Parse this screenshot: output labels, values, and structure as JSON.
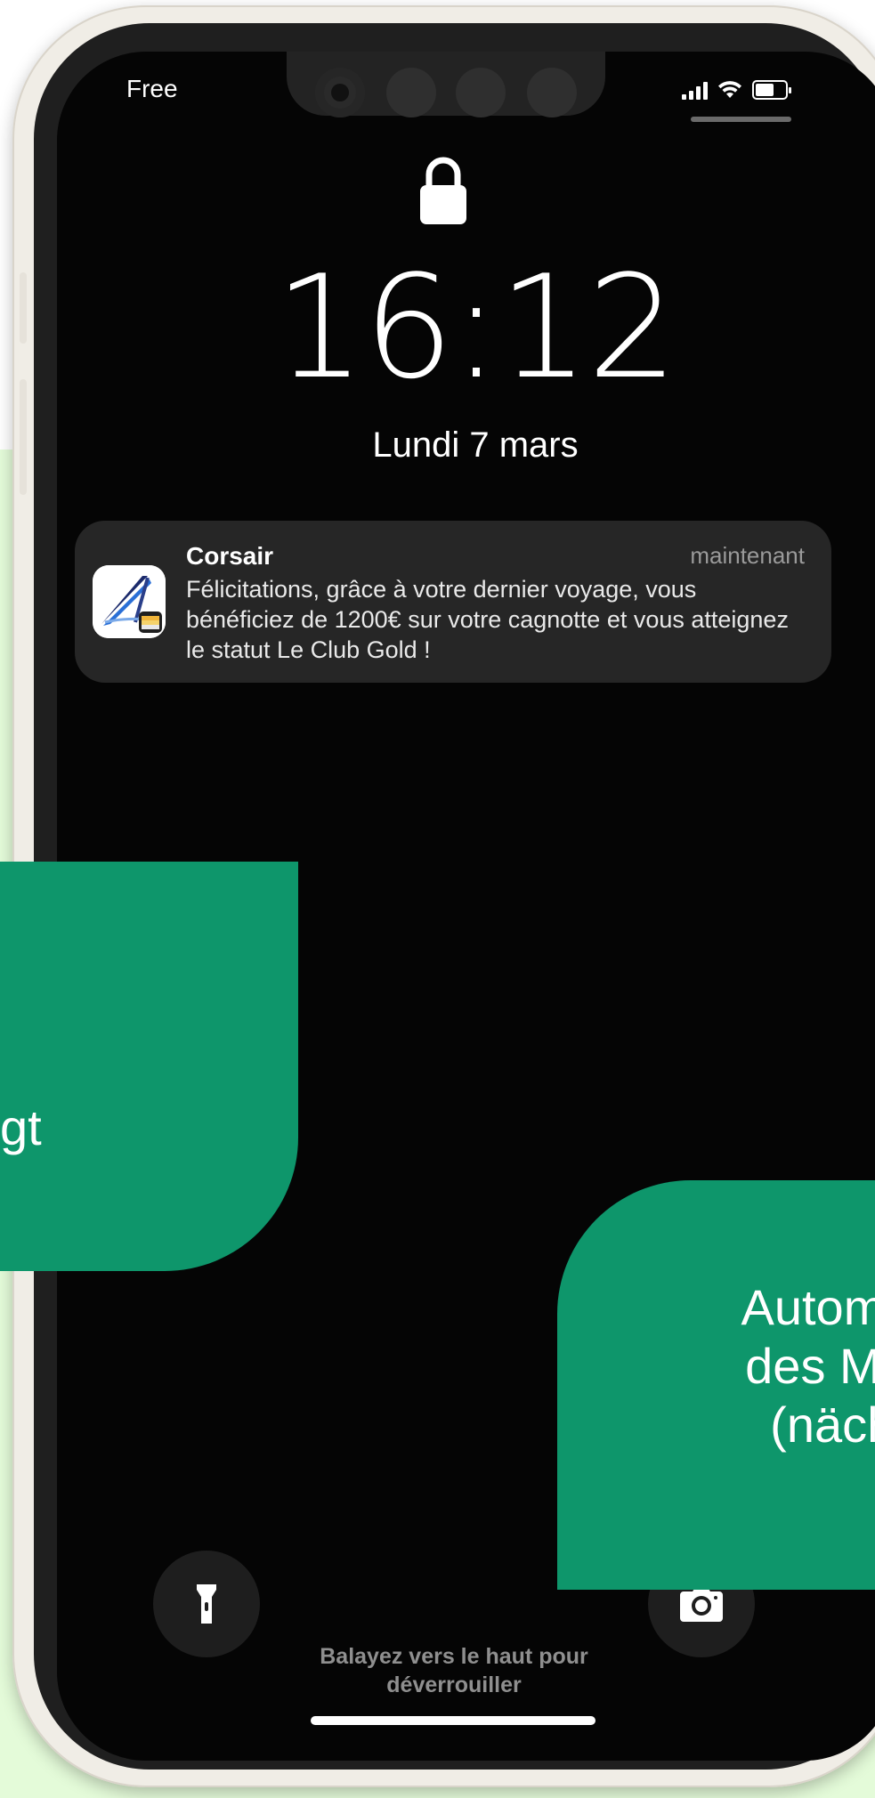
{
  "status_bar": {
    "carrier": "Free",
    "signal_icon": "cellular-signal-icon",
    "wifi_icon": "wifi-icon",
    "battery_icon": "battery-icon"
  },
  "lock_screen": {
    "lock_icon": "lock-icon",
    "time": "16:12",
    "date": "Lundi 7 mars",
    "unlock_hint_line1": "Balayez vers le haut pour",
    "unlock_hint_line2": "déverrouiller",
    "flashlight_icon": "flashlight-icon",
    "camera_icon": "camera-icon"
  },
  "notification": {
    "app_name": "Corsair",
    "time": "maintenant",
    "message": "Félicitations, grâce à votre dernier voyage, vous bénéficiez de 1200€ sur votre cagnotte et vous atteignez le statut Le Club Gold !",
    "app_icon": "corsair-wallet-icon"
  },
  "overlays": {
    "left_bubble_text": "gt",
    "right_bubble_line1": "Automatis",
    "right_bubble_line2": "des Meile",
    "right_bubble_line3": "(nächst"
  },
  "colors": {
    "bubble_green": "#0e966b",
    "background_green": "#e4fbd9",
    "screen_black": "#050505",
    "notification_bg": "#262626"
  }
}
